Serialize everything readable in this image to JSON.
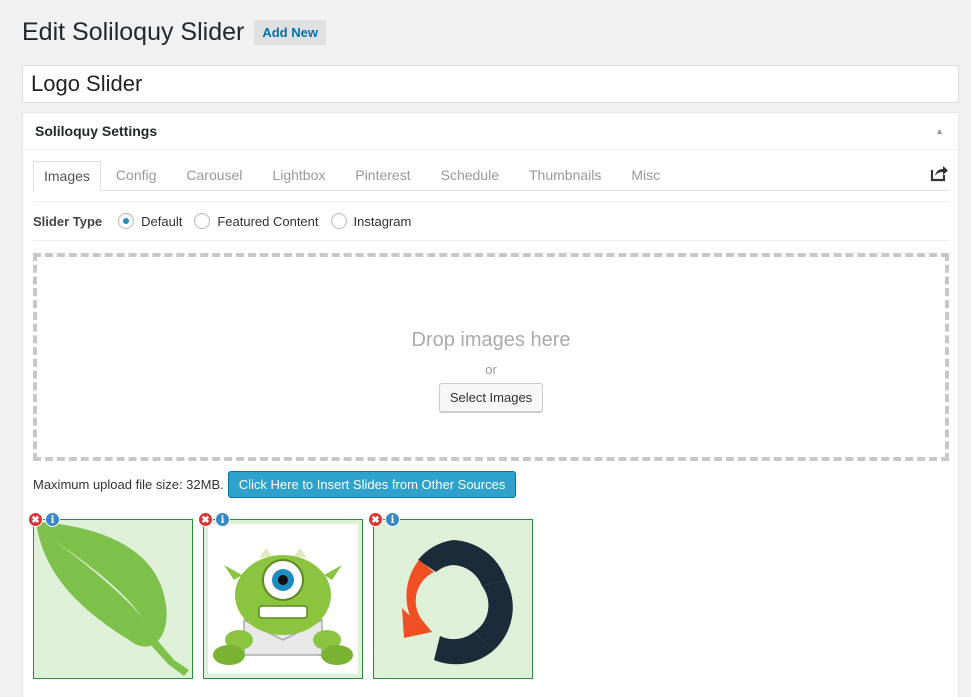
{
  "header": {
    "title": "Edit Soliloquy Slider",
    "add_new_label": "Add New"
  },
  "post_title": {
    "value": "Logo Slider"
  },
  "settings": {
    "title": "Soliloquy Settings",
    "tabs": [
      {
        "label": "Images"
      },
      {
        "label": "Config"
      },
      {
        "label": "Carousel"
      },
      {
        "label": "Lightbox"
      },
      {
        "label": "Pinterest"
      },
      {
        "label": "Schedule"
      },
      {
        "label": "Thumbnails"
      },
      {
        "label": "Misc"
      }
    ],
    "active_tab": "Images",
    "slider_type": {
      "label": "Slider Type",
      "options": [
        {
          "label": "Default"
        },
        {
          "label": "Featured Content"
        },
        {
          "label": "Instagram"
        }
      ],
      "selected": "Default"
    },
    "dropzone": {
      "title": "Drop images here",
      "or": "or",
      "select_label": "Select Images"
    },
    "upload": {
      "note": "Maximum upload file size: 32MB.",
      "insert_label": "Click Here to Insert Slides from Other Sources"
    },
    "slides": [
      {
        "icon": "leaf-logo"
      },
      {
        "icon": "monster-mascot"
      },
      {
        "icon": "circular-arrows-logo"
      }
    ]
  },
  "colors": {
    "accent": "#2ea2cc",
    "link": "#0073aa",
    "slide_bg": "#dff0d8",
    "remove": "#dd3333",
    "info": "#3a87c6"
  }
}
